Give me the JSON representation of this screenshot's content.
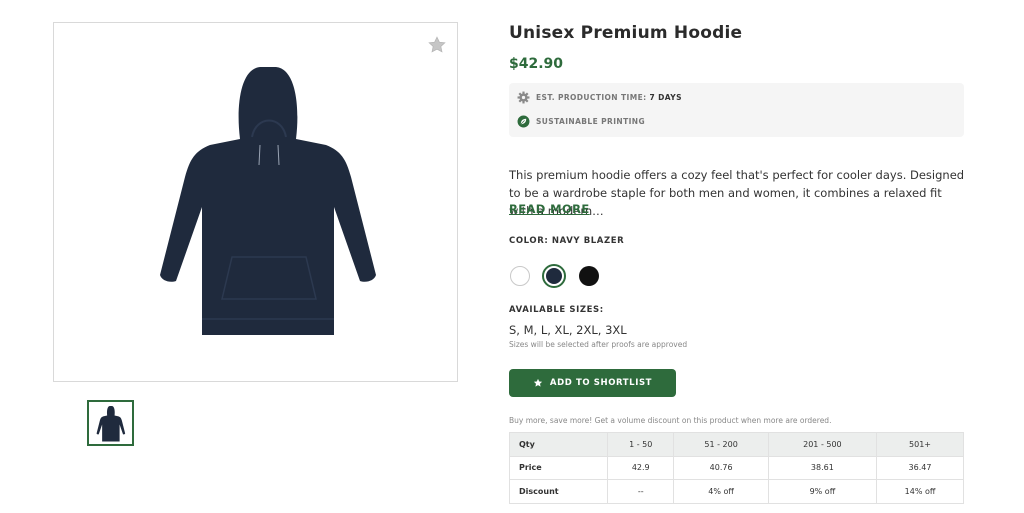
{
  "product": {
    "title": "Unisex Premium Hoodie",
    "price": "$42.90",
    "info": {
      "production_label": "EST. PRODUCTION TIME:",
      "production_value": "7 DAYS",
      "sustainable_label": "SUSTAINABLE PRINTING"
    },
    "description": "This premium hoodie offers a cozy feel that's perfect for cooler days. Designed to be a wardrobe staple for both men and women, it combines a relaxed fit with a modern…",
    "read_more": "READ MORE",
    "color_label": "COLOR: NAVY BLAZER",
    "colors": [
      {
        "name": "white",
        "hex": "#ffffff",
        "selected": false
      },
      {
        "name": "navy-blazer",
        "hex": "#1f2a3d",
        "selected": true
      },
      {
        "name": "black",
        "hex": "#111111",
        "selected": false
      }
    ],
    "sizes_label": "AVAILABLE SIZES:",
    "sizes_value": "S, M, L, XL, 2XL, 3XL",
    "sizes_note": "Sizes will be selected after proofs are approved",
    "shortlist_label": "ADD TO SHORTLIST",
    "volume_note": "Buy more, save more! Get a volume discount on this product when more are ordered."
  },
  "pricing_table": {
    "headers": [
      "Qty",
      "1 - 50",
      "51 - 200",
      "201 - 500",
      "501+"
    ],
    "rows": [
      [
        "Price",
        "42.9",
        "40.76",
        "38.61",
        "36.47"
      ],
      [
        "Discount",
        "--",
        "4% off",
        "9% off",
        "14% off"
      ]
    ]
  },
  "colors": {
    "accent": "#2e6b3c",
    "hoodie": "#1f2a3d"
  },
  "icons": [
    "star-icon",
    "gear-icon",
    "leaf-icon"
  ]
}
